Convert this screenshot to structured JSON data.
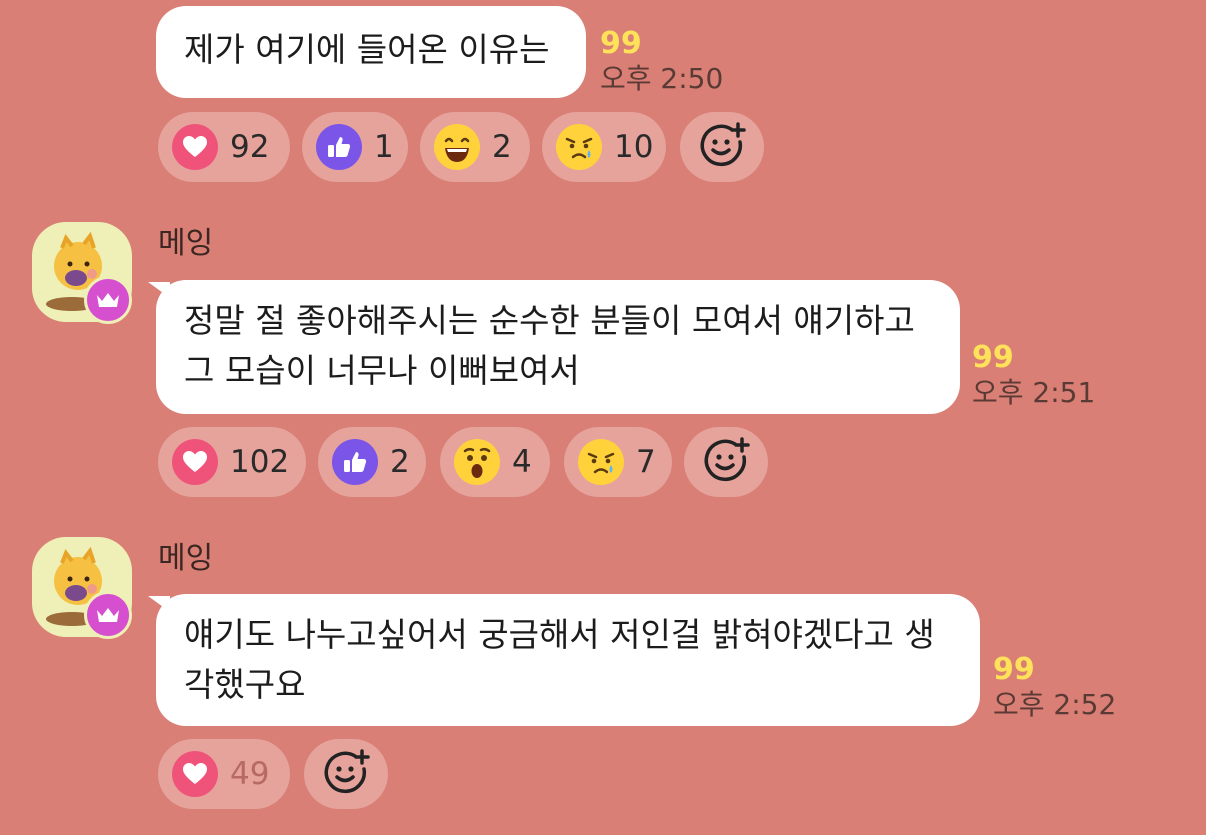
{
  "messages": [
    {
      "text": "제가 여기에 들어온 이유는",
      "unread": "99",
      "time": "오후 2:50",
      "reactions": [
        {
          "type": "heart",
          "count": "92"
        },
        {
          "type": "thumbs-up",
          "count": "1"
        },
        {
          "type": "grinning-face",
          "count": "2"
        },
        {
          "type": "crying-face",
          "count": "10"
        }
      ]
    },
    {
      "sender": "메잉",
      "text_lines": [
        "정말 절 좋아해주시는 순수한 분들이 모여서 얘기하고",
        "그 모습이 너무나 이뻐보여서"
      ],
      "unread": "99",
      "time": "오후 2:51",
      "reactions": [
        {
          "type": "heart",
          "count": "102"
        },
        {
          "type": "thumbs-up",
          "count": "2"
        },
        {
          "type": "surprised-face",
          "count": "4"
        },
        {
          "type": "crying-face",
          "count": "7"
        }
      ]
    },
    {
      "sender": "메잉",
      "text_lines": [
        "얘기도 나누고싶어서 궁금해서 저인걸 밝혀야겠다고 생",
        "각했구요"
      ],
      "unread": "99",
      "time": "오후 2:52",
      "reactions": [
        {
          "type": "heart",
          "count": "49"
        }
      ]
    }
  ],
  "colors": {
    "background": "#d97f75",
    "bubble": "#ffffff",
    "unread": "#ffe15a",
    "reaction_pill": "#e5a39c",
    "heart": "#f0537a",
    "thumbs_up": "#7a55e8",
    "crown_badge": "#d64fcf"
  }
}
